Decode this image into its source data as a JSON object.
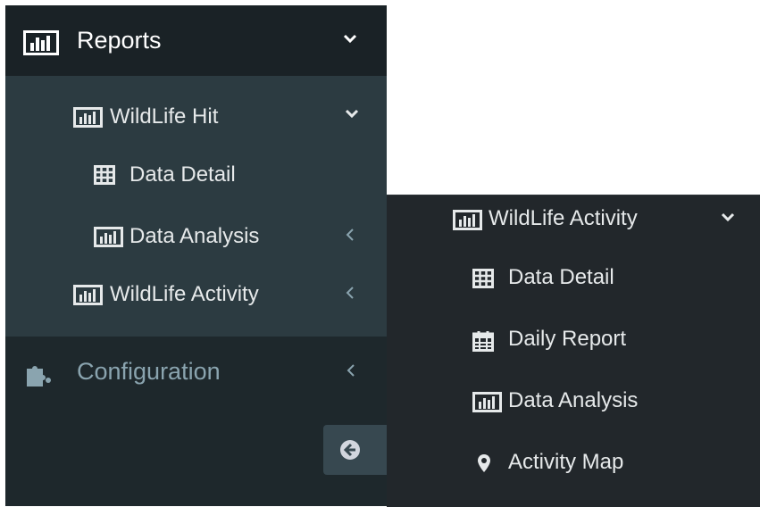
{
  "left_menu": {
    "header": {
      "label": "Reports",
      "icon": "bar-chart-icon",
      "state": "expanded"
    },
    "items": [
      {
        "label": "WildLife Hit",
        "icon": "bar-chart-icon",
        "state": "expanded"
      },
      {
        "label": "Data Detail",
        "icon": "table-icon"
      },
      {
        "label": "Data Analysis",
        "icon": "bar-chart-icon",
        "state": "collapsed"
      },
      {
        "label": "WildLife Activity",
        "icon": "bar-chart-icon",
        "state": "collapsed"
      }
    ],
    "configuration": {
      "label": "Configuration",
      "icon": "puzzle-icon",
      "state": "collapsed"
    },
    "collapse_button": {
      "icon": "arrow-circle-left-icon"
    }
  },
  "right_menu": {
    "header": {
      "label": "WildLife Activity",
      "icon": "bar-chart-icon",
      "state": "expanded"
    },
    "items": [
      {
        "label": "Data Detail",
        "icon": "table-icon"
      },
      {
        "label": "Daily Report",
        "icon": "calendar-icon"
      },
      {
        "label": "Data Analysis",
        "icon": "bar-chart-icon"
      },
      {
        "label": "Activity Map",
        "icon": "map-marker-icon"
      }
    ]
  },
  "colors": {
    "sidebar_bg": "#1e282c",
    "submenu_bg": "#2c3b41",
    "text": "#e6e9ea",
    "muted_text": "#8aa4af"
  }
}
